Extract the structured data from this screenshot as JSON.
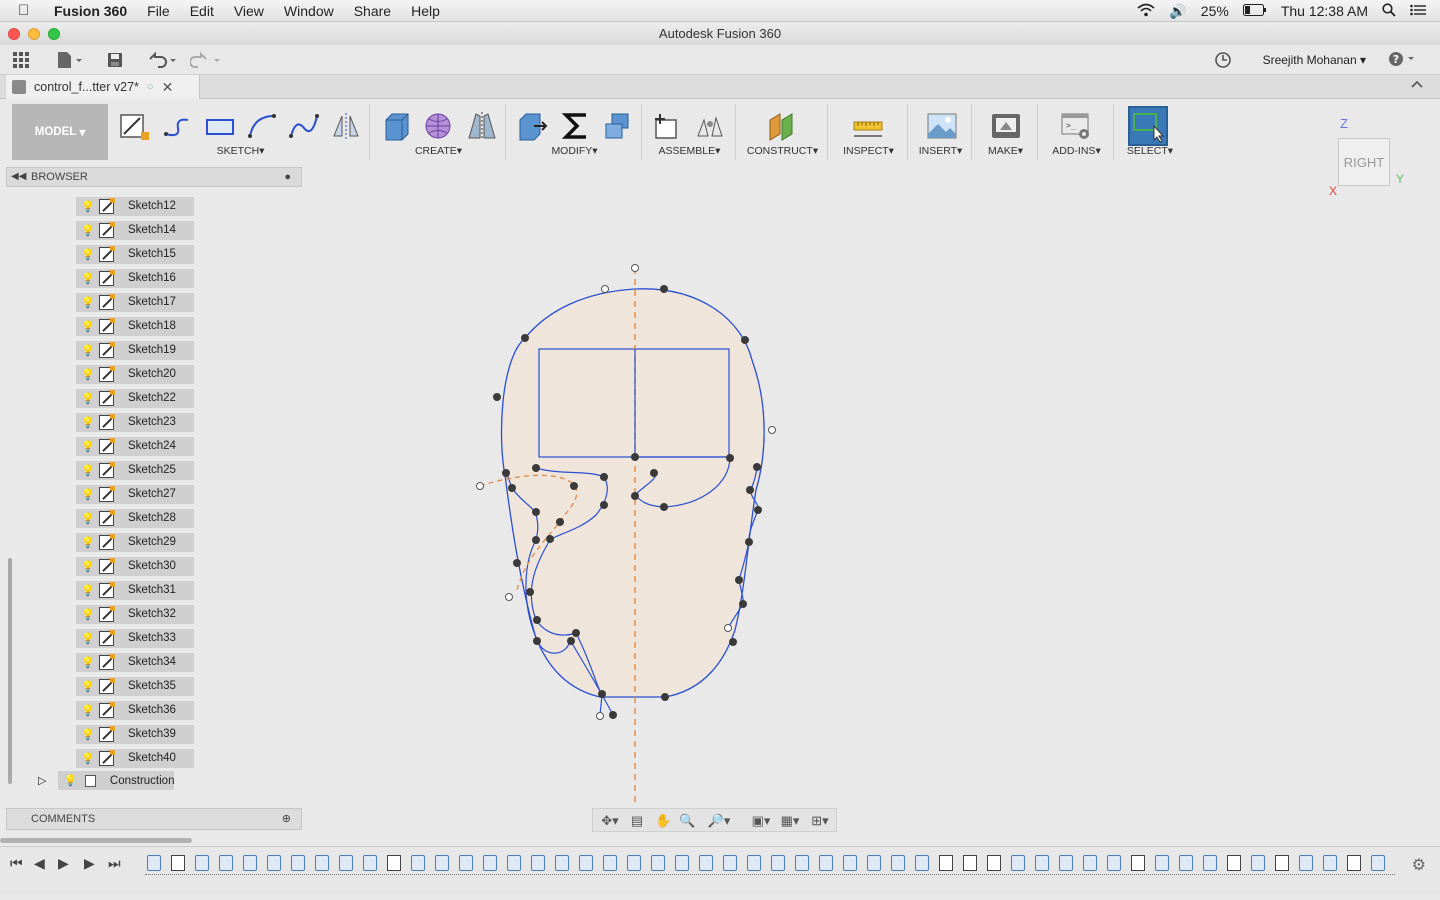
{
  "menubar": {
    "app_name": "Fusion 360",
    "items": [
      "File",
      "Edit",
      "View",
      "Window",
      "Share",
      "Help"
    ],
    "battery": "25%",
    "clock": "Thu 12:38 AM"
  },
  "window": {
    "title": "Autodesk Fusion 360"
  },
  "quick_access": {
    "user_name": "Sreejith Mohanan"
  },
  "doc_tab": {
    "label": "control_f...tter v27*"
  },
  "toolbar": {
    "mode": "MODEL",
    "groups": [
      {
        "label": "SKETCH"
      },
      {
        "label": "CREATE"
      },
      {
        "label": "MODIFY"
      },
      {
        "label": "ASSEMBLE"
      },
      {
        "label": "CONSTRUCT"
      },
      {
        "label": "INSPECT"
      },
      {
        "label": "INSERT"
      },
      {
        "label": "MAKE"
      },
      {
        "label": "ADD-INS"
      },
      {
        "label": "SELECT"
      }
    ]
  },
  "viewcube": {
    "face": "RIGHT",
    "axis_z": "Z",
    "axis_y": "Y",
    "axis_x": "X"
  },
  "browser": {
    "title": "BROWSER",
    "items": [
      "Sketch12",
      "Sketch14",
      "Sketch15",
      "Sketch16",
      "Sketch17",
      "Sketch18",
      "Sketch19",
      "Sketch20",
      "Sketch22",
      "Sketch23",
      "Sketch24",
      "Sketch25",
      "Sketch27",
      "Sketch28",
      "Sketch29",
      "Sketch30",
      "Sketch31",
      "Sketch32",
      "Sketch33",
      "Sketch34",
      "Sketch35",
      "Sketch36",
      "Sketch39",
      "Sketch40"
    ],
    "folder": "Construction"
  },
  "comments": {
    "title": "COMMENTS"
  },
  "colors": {
    "sketch_fill": "#efe5da",
    "sketch_line": "#2a4fd0",
    "construction_line": "#e08a4a",
    "select_active": "#3a79b8"
  }
}
